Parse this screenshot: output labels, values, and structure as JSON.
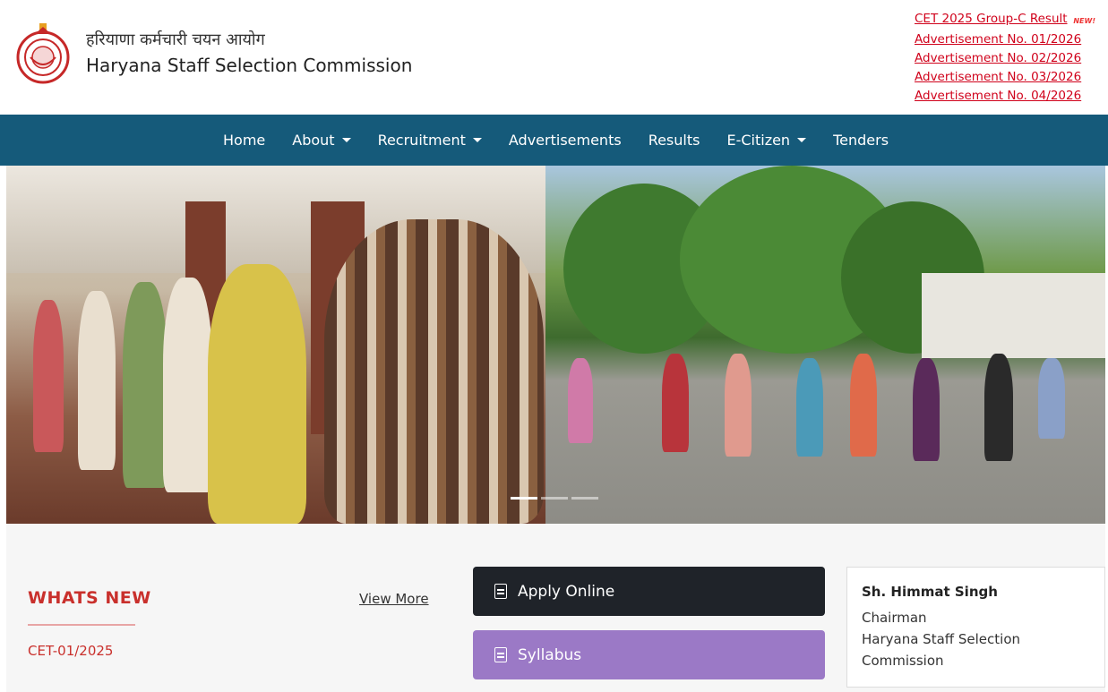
{
  "header": {
    "title_hindi": "हरियाणा कर्मचारी चयन आयोग",
    "title_english": "Haryana Staff Selection Commission",
    "notices": [
      {
        "label": "CET 2025 Group-C Result",
        "badge": "NEW!"
      },
      {
        "label": "Advertisement No. 01/2026"
      },
      {
        "label": "Advertisement No. 02/2026"
      },
      {
        "label": "Advertisement No. 03/2026"
      },
      {
        "label": "Advertisement No. 04/2026"
      }
    ]
  },
  "nav": {
    "items": [
      {
        "label": "Home",
        "dropdown": false
      },
      {
        "label": "About",
        "dropdown": true
      },
      {
        "label": "Recruitment",
        "dropdown": true
      },
      {
        "label": "Advertisements",
        "dropdown": false
      },
      {
        "label": "Results",
        "dropdown": false
      },
      {
        "label": "E-Citizen",
        "dropdown": true
      },
      {
        "label": "Tenders",
        "dropdown": false
      }
    ]
  },
  "carousel": {
    "slides_count": 3,
    "active_slide": 1
  },
  "whats_new": {
    "heading": "WHATS NEW",
    "view_more": "View More",
    "items": [
      "CET-01/2025"
    ]
  },
  "actions": {
    "apply_online": "Apply Online",
    "syllabus": "Syllabus"
  },
  "chairman": {
    "name": "Sh. Himmat Singh",
    "role": "Chairman",
    "org_line1": "Haryana Staff Selection",
    "org_line2": "Commission"
  },
  "colors": {
    "nav_bg": "#155a7a",
    "link_red": "#d0021b",
    "accent_red": "#c9302c",
    "apply_btn": "#1f2329",
    "syllabus_btn": "#9b79c6"
  }
}
